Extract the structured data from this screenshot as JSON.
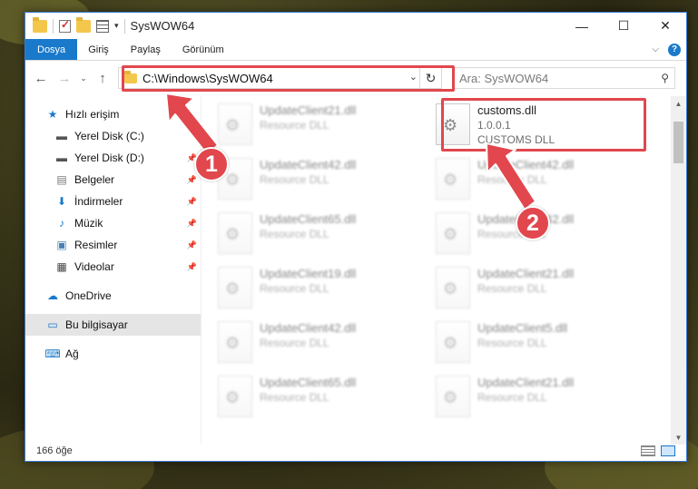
{
  "window": {
    "title": "SysWOW64",
    "controls": {
      "minimize": "—",
      "maximize": "☐",
      "close": "✕"
    }
  },
  "ribbon": {
    "tabs": [
      "Dosya",
      "Giriş",
      "Paylaş",
      "Görünüm"
    ],
    "help": "?"
  },
  "navbar": {
    "address": "C:\\Windows\\SysWOW64",
    "search_placeholder": "Ara: SysWOW64"
  },
  "sidebar": {
    "quick_access": "Hızlı erişim",
    "items": [
      {
        "label": "Yerel Disk (C:)",
        "icon": "drive-icon"
      },
      {
        "label": "Yerel Disk (D:)",
        "icon": "drive-icon"
      },
      {
        "label": "Belgeler",
        "icon": "documents-icon"
      },
      {
        "label": "İndirmeler",
        "icon": "download-icon"
      },
      {
        "label": "Müzik",
        "icon": "music-icon"
      },
      {
        "label": "Resimler",
        "icon": "pictures-icon"
      },
      {
        "label": "Videolar",
        "icon": "video-icon"
      }
    ],
    "onedrive": "OneDrive",
    "this_pc": "Bu bilgisayar",
    "network": "Ağ"
  },
  "files": {
    "highlighted": {
      "name": "customs.dll",
      "version": "1.0.0.1",
      "desc": "CUSTOMS DLL"
    },
    "left_col": [
      {
        "name": "UpdateClient21.dll",
        "desc": "Resource DLL"
      },
      {
        "name": "UpdateClient42.dll",
        "desc": "Resource DLL"
      },
      {
        "name": "UpdateClient65.dll",
        "desc": "Resource DLL"
      },
      {
        "name": "UpdateClient19.dll",
        "desc": "Resource DLL"
      },
      {
        "name": "UpdateClient42.dll",
        "desc": "Resource DLL"
      },
      {
        "name": "UpdateClient65.dll",
        "desc": "Resource DLL"
      }
    ],
    "right_col": [
      {
        "name": "UpdateClient42.dll",
        "desc": "Resource DLL"
      },
      {
        "name": "UpdateClient42.dll",
        "desc": "Resource DLL"
      },
      {
        "name": "UpdateClient21.dll",
        "desc": "Resource DLL"
      },
      {
        "name": "UpdateClient5.dll",
        "desc": "Resource DLL"
      },
      {
        "name": "UpdateClient21.dll",
        "desc": "Resource DLL"
      }
    ]
  },
  "status": {
    "count": "166 öğe"
  },
  "annotations": {
    "badge1": "1",
    "badge2": "2",
    "color": "#e1474d"
  }
}
